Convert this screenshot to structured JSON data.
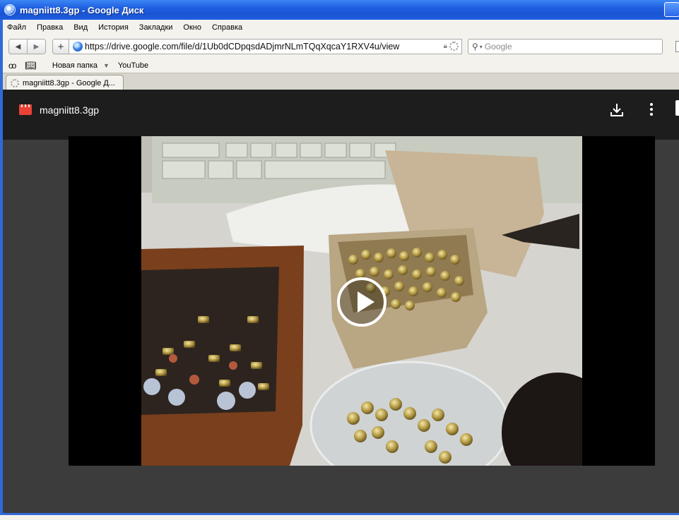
{
  "window": {
    "title": "magniitt8.3gp - Google Диск"
  },
  "menu": [
    "Файл",
    "Правка",
    "Вид",
    "История",
    "Закладки",
    "Окно",
    "Справка"
  ],
  "nav": {
    "url": "https://drive.google.com/file/d/1Ub0dCDpqsdADjmrNLmTQqXqcaY1RXV4u/view",
    "search_placeholder": "Google",
    "add_label": "+"
  },
  "bookmarks": {
    "folder": "Новая папка",
    "youtube": "YouTube"
  },
  "tab": {
    "label": "magniitt8.3gp - Google Д..."
  },
  "viewer": {
    "file_name": "magniitt8.3gp"
  },
  "icons": [
    "browser-icon",
    "back-icon",
    "forward-icon",
    "globe-icon",
    "lock-icon",
    "loading-icon",
    "search-icon",
    "glasses-icon",
    "book-icon",
    "dropdown-arrow-icon",
    "video-file-icon",
    "download-icon",
    "more-vert-icon",
    "play-icon"
  ]
}
